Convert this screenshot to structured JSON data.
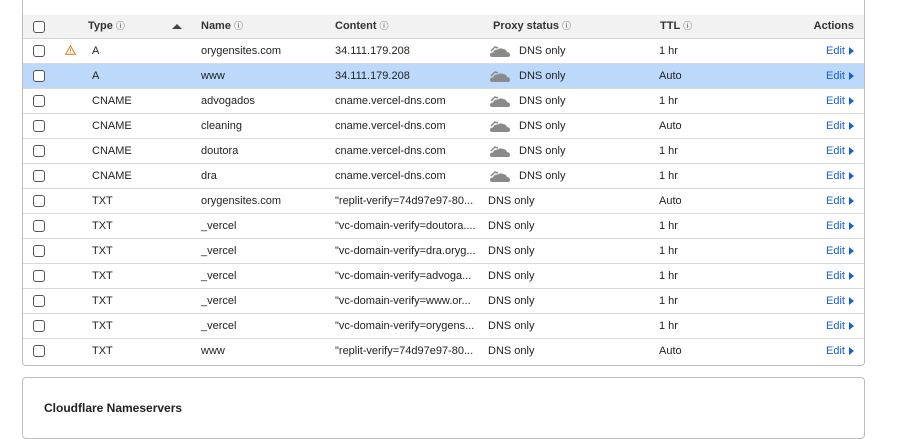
{
  "table": {
    "headers": {
      "type": "Type",
      "name": "Name",
      "content": "Content",
      "proxy": "Proxy status",
      "ttl": "TTL",
      "actions": "Actions"
    },
    "info_icon": "ⓘ",
    "edit_label": "Edit",
    "rows": [
      {
        "type": "A",
        "name": "orygensites.com",
        "content": "34.111.179.208",
        "proxy": "DNS only",
        "ttl": "1 hr",
        "cloud": true,
        "warning": "⚠",
        "selected": false
      },
      {
        "type": "A",
        "name": "www",
        "content": "34.111.179.208",
        "proxy": "DNS only",
        "ttl": "Auto",
        "cloud": true,
        "selected": true
      },
      {
        "type": "CNAME",
        "name": "advogados",
        "content": "cname.vercel-dns.com",
        "proxy": "DNS only",
        "ttl": "1 hr",
        "cloud": true
      },
      {
        "type": "CNAME",
        "name": "cleaning",
        "content": "cname.vercel-dns.com",
        "proxy": "DNS only",
        "ttl": "Auto",
        "cloud": true
      },
      {
        "type": "CNAME",
        "name": "doutora",
        "content": "cname.vercel-dns.com",
        "proxy": "DNS only",
        "ttl": "1 hr",
        "cloud": true
      },
      {
        "type": "CNAME",
        "name": "dra",
        "content": "cname.vercel-dns.com",
        "proxy": "DNS only",
        "ttl": "1 hr",
        "cloud": true
      },
      {
        "type": "TXT",
        "name": "orygensites.com",
        "content": "\"replit-verify=74d97e97-80...",
        "proxy": "DNS only",
        "ttl": "Auto",
        "cloud": false
      },
      {
        "type": "TXT",
        "name": "_vercel",
        "content": "\"vc-domain-verify=doutora....",
        "proxy": "DNS only",
        "ttl": "1 hr",
        "cloud": false
      },
      {
        "type": "TXT",
        "name": "_vercel",
        "content": "\"vc-domain-verify=dra.oryg...",
        "proxy": "DNS only",
        "ttl": "1 hr",
        "cloud": false
      },
      {
        "type": "TXT",
        "name": "_vercel",
        "content": "\"vc-domain-verify=advoga...",
        "proxy": "DNS only",
        "ttl": "1 hr",
        "cloud": false
      },
      {
        "type": "TXT",
        "name": "_vercel",
        "content": "\"vc-domain-verify=www.or...",
        "proxy": "DNS only",
        "ttl": "1 hr",
        "cloud": false
      },
      {
        "type": "TXT",
        "name": "_vercel",
        "content": "\"vc-domain-verify=orygens...",
        "proxy": "DNS only",
        "ttl": "1 hr",
        "cloud": false
      },
      {
        "type": "TXT",
        "name": "www",
        "content": "\"replit-verify=74d97e97-80...",
        "proxy": "DNS only",
        "ttl": "Auto",
        "cloud": false
      }
    ]
  },
  "nameservers": {
    "title": "Cloudflare Nameservers"
  },
  "colors": {
    "selected_row": "#bcd8fb",
    "link": "#1a5fd0",
    "warning": "#e08a2c"
  }
}
